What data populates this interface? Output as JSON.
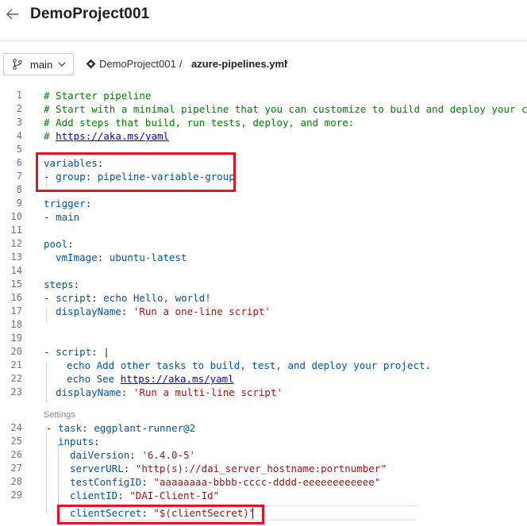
{
  "header": {
    "title": "DemoProject001"
  },
  "toolbar": {
    "branch": "main",
    "repo": "DemoProject001",
    "separator": "/",
    "file": "azure-pipelines.yml",
    "modified": "*"
  },
  "editor": {
    "settings_label": "Settings",
    "lines": {
      "l1": {
        "num": "1",
        "text": "# Starter pipeline"
      },
      "l2": {
        "num": "2",
        "text": "# Start with a minimal pipeline that you can customize to build and deploy your code."
      },
      "l3": {
        "num": "3",
        "text": "# Add steps that build, run tests, deploy, and more:"
      },
      "l4": {
        "num": "4",
        "hash": "# ",
        "link": "https://aka.ms/yaml"
      },
      "l5": {
        "num": "5"
      },
      "l6": {
        "num": "6",
        "key": "variables",
        "colon": ":"
      },
      "l7": {
        "num": "7",
        "dash": "- ",
        "key": "group",
        "colon": ": ",
        "value": "pipeline-variable-group"
      },
      "l8": {
        "num": "8"
      },
      "l9": {
        "num": "9",
        "key": "trigger",
        "colon": ":"
      },
      "l10": {
        "num": "10",
        "dash": "- ",
        "value": "main"
      },
      "l11": {
        "num": "11"
      },
      "l12": {
        "num": "12",
        "key": "pool",
        "colon": ":"
      },
      "l13": {
        "num": "13",
        "key": "vmImage",
        "colon": ": ",
        "value": "ubuntu-latest"
      },
      "l14": {
        "num": "14"
      },
      "l15": {
        "num": "15",
        "key": "steps",
        "colon": ":"
      },
      "l16": {
        "num": "16",
        "dash": "- ",
        "key": "script",
        "colon": ": ",
        "value": "echo Hello, world!"
      },
      "l17": {
        "num": "17",
        "key": "displayName",
        "colon": ": ",
        "value": "'Run a one-line script'"
      },
      "l18": {
        "num": "18"
      },
      "l19": {
        "num": "19"
      },
      "l20": {
        "num": "20",
        "dash": "- ",
        "key": "script",
        "colon": ": ",
        "value": "|"
      },
      "l21": {
        "num": "21",
        "value": "echo Add other tasks to build, test, and deploy your project."
      },
      "l22": {
        "num": "22",
        "value": "echo See ",
        "link": "https://aka.ms/yaml"
      },
      "l23": {
        "num": "23",
        "key": "displayName",
        "colon": ": ",
        "value": "'Run a multi-line script'"
      },
      "l24": {
        "num": "24",
        "dash": "- ",
        "key": "task",
        "colon": ": ",
        "value": "eggplant-runner@2"
      },
      "l25": {
        "num": "25",
        "key": "inputs",
        "colon": ":"
      },
      "l26": {
        "num": "26",
        "key": "daiVersion",
        "colon": ": ",
        "value": "'6.4.0-5'"
      },
      "l27": {
        "num": "27",
        "key": "serverURL",
        "colon": ": ",
        "value": "\"http(s)://dai_server_hostname:portnumber\""
      },
      "l28": {
        "num": "28",
        "key": "testConfigID",
        "colon": ": ",
        "value": "\"aaaaaaaa-bbbb-cccc-dddd-eeeeeeeeeeee\""
      },
      "l29": {
        "num": "29",
        "key": "clientID",
        "colon": ": ",
        "value": "\"DAI-Client-Id\""
      },
      "l30": {
        "key": "clientSecret",
        "colon": ": ",
        "value": "\"$(clientSecret)\""
      }
    }
  },
  "colors": {
    "highlight": "#e81123",
    "comment": "#008000",
    "key": "#0451a5",
    "link": "#0000ee"
  }
}
